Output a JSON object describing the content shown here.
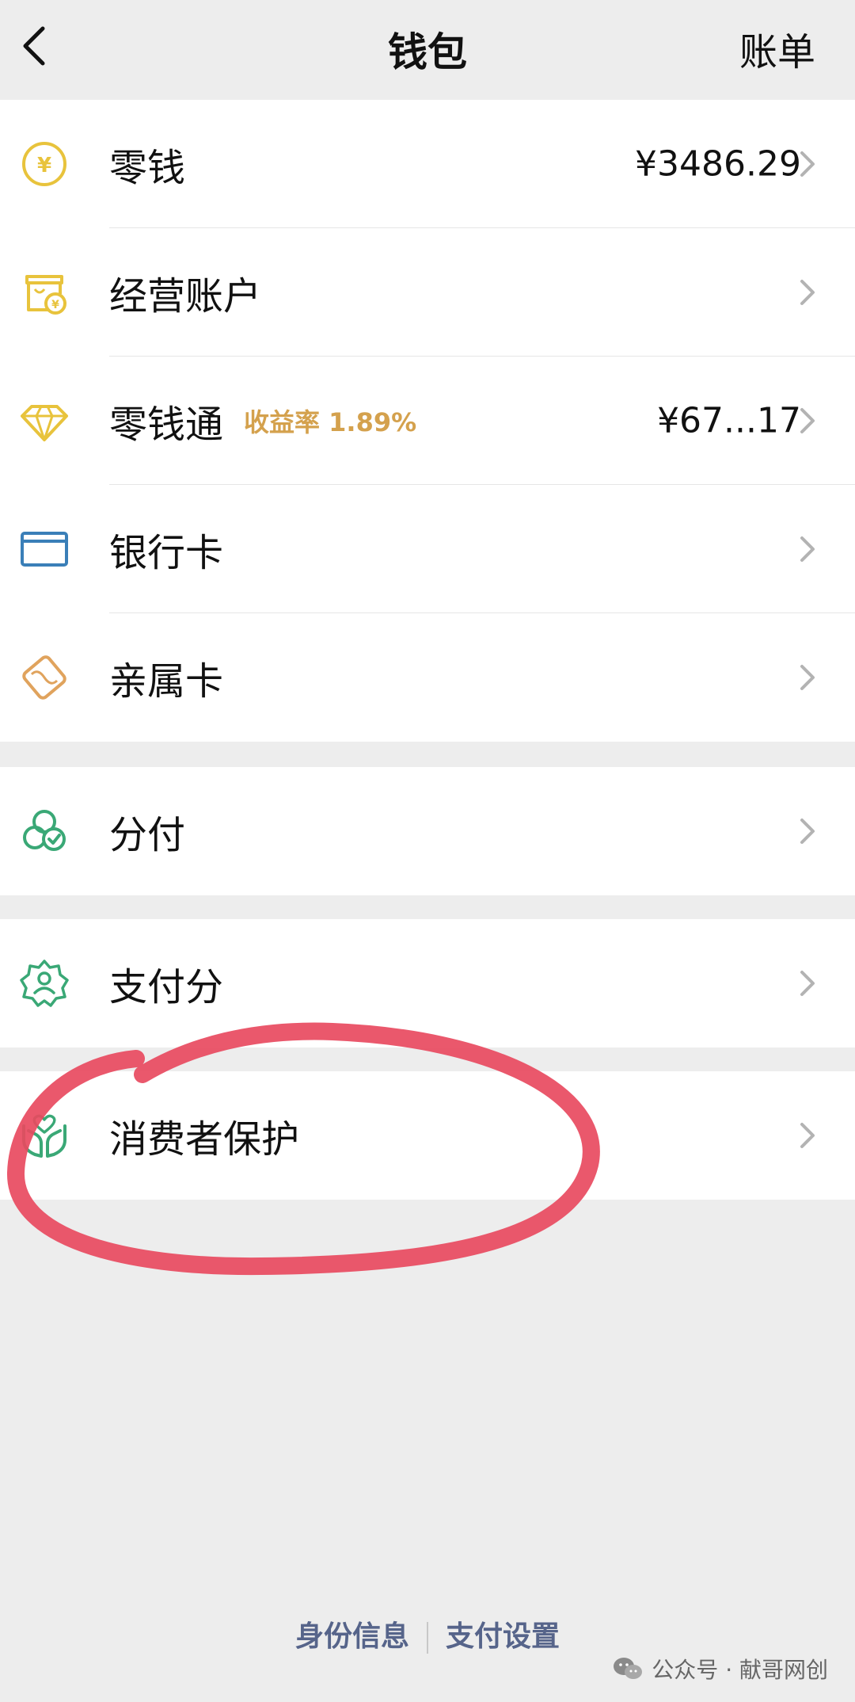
{
  "nav": {
    "title": "钱包",
    "right_action": "账单"
  },
  "wallet_group": [
    {
      "label": "零钱",
      "value": "¥3486.29",
      "icon": "yuan-coin-icon"
    },
    {
      "label": "经营账户",
      "value": "",
      "icon": "shop-account-icon"
    },
    {
      "label": "零钱通",
      "badge": "收益率 1.89%",
      "value": "¥67...17",
      "icon": "diamond-icon"
    },
    {
      "label": "银行卡",
      "value": "",
      "icon": "bank-card-icon"
    },
    {
      "label": "亲属卡",
      "value": "",
      "icon": "family-card-icon"
    }
  ],
  "installment_group": [
    {
      "label": "分付",
      "icon": "installment-icon"
    }
  ],
  "score_group": [
    {
      "label": "支付分",
      "icon": "pay-score-icon"
    }
  ],
  "protection_group": [
    {
      "label": "消费者保护",
      "icon": "consumer-protection-icon"
    }
  ],
  "footer": {
    "links": [
      "身份信息",
      "支付设置"
    ]
  },
  "watermark": "公众号 · 献哥网创",
  "colors": {
    "yellow": "#e8c33c",
    "green": "#3aa876",
    "blue": "#3a7fb8",
    "orange": "#e0a35d",
    "annotation_red": "#e84a5f",
    "link_blue": "#56648a"
  }
}
